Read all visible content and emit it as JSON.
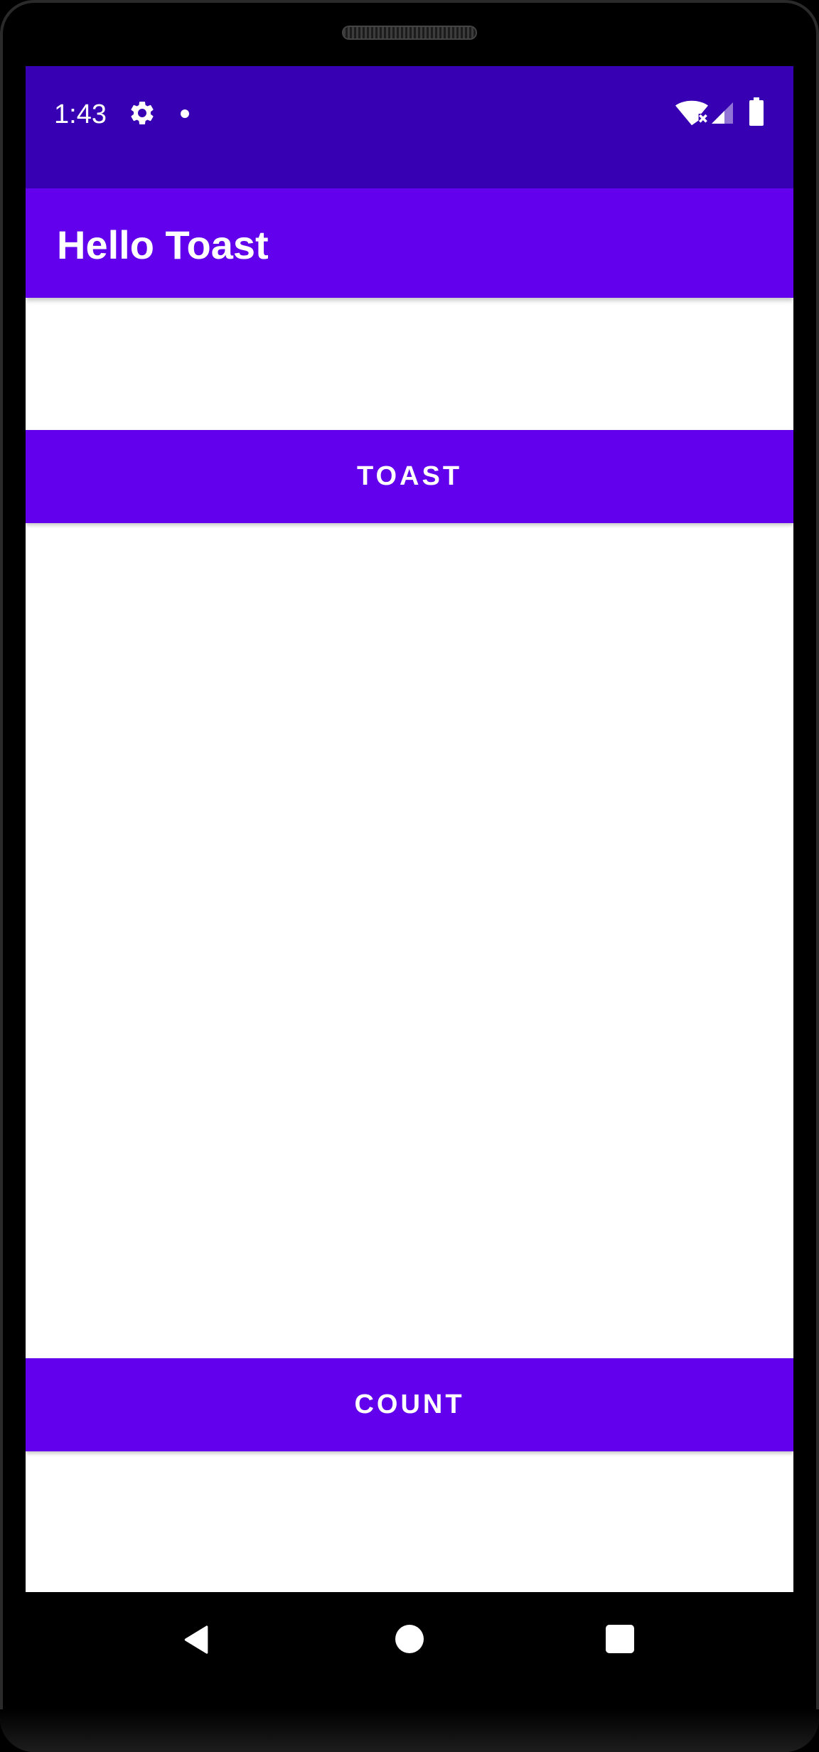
{
  "status_bar": {
    "time": "1:43",
    "icons": [
      "gear-icon",
      "notification-dot-icon",
      "wifi-no-internet-icon",
      "cell-signal-icon",
      "battery-icon"
    ],
    "color": "#3700B3"
  },
  "app_bar": {
    "title": "Hello Toast",
    "color": "#6200EE"
  },
  "buttons": {
    "toast_label": "TOAST",
    "count_label": "COUNT",
    "color": "#6200EE"
  },
  "count_value": "",
  "nav_bar": {
    "icons": [
      "back-icon",
      "home-icon",
      "recents-icon"
    ]
  }
}
